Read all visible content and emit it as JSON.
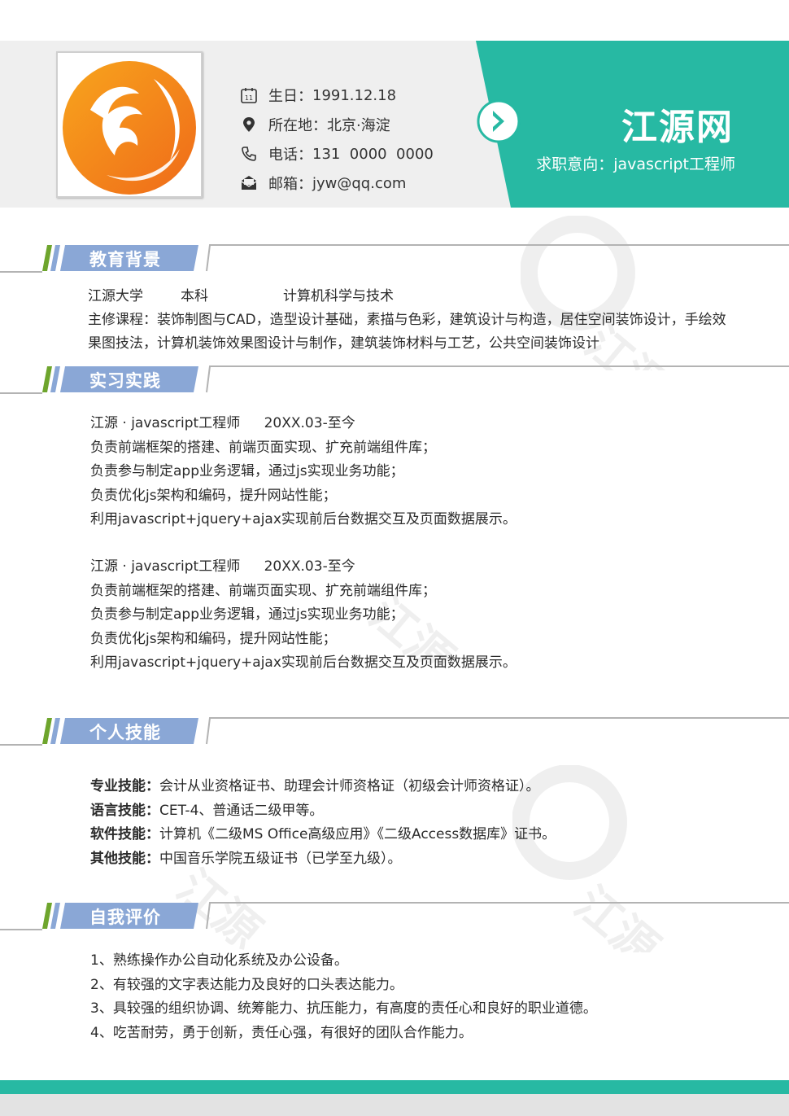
{
  "colors": {
    "teal": "#27b9a3",
    "section_blue": "#8aa7d6",
    "stripe_green": "#6ea52d",
    "header_bg": "#efefef"
  },
  "header": {
    "birthday_label": "生日：",
    "birthday": "1991.12.18",
    "location_label": "所在地：",
    "location": "北京·海淀",
    "phone_label": "电话：",
    "phone": "131  0000  0000",
    "email_label": "邮箱：",
    "email": "jyw@qq.com",
    "calendar_day": "11",
    "name": "江源网",
    "objective": "求职意向：javascript工程师"
  },
  "sections": {
    "education": "教育背景",
    "internship": "实习实践",
    "skills": "个人技能",
    "self_eval": "自我评价"
  },
  "education": {
    "school": "江源大学",
    "degree": "本科",
    "major": "计算机科学与技术",
    "courses_line1": "主修课程：装饰制图与CAD，造型设计基础，素描与色彩，建筑设计与构造，居住空间装饰设计，手绘效",
    "courses_line2": "果图技法，计算机装饰效果图设计与制作，建筑装饰材料与工艺，公共空间装饰设计"
  },
  "experience": [
    {
      "title": "江源 · javascript工程师",
      "period": "20XX.03-至今",
      "lines": [
        "负责前端框架的搭建、前端页面实现、扩充前端组件库；",
        "负责参与制定app业务逻辑，通过js实现业务功能；",
        "负责优化js架构和编码，提升网站性能；",
        "利用javascript+jquery+ajax实现前后台数据交互及页面数据展示。"
      ]
    },
    {
      "title": "江源 · javascript工程师",
      "period": "20XX.03-至今",
      "lines": [
        "负责前端框架的搭建、前端页面实现、扩充前端组件库；",
        "负责参与制定app业务逻辑，通过js实现业务功能；",
        "负责优化js架构和编码，提升网站性能；",
        "利用javascript+jquery+ajax实现前后台数据交互及页面数据展示。"
      ]
    }
  ],
  "skills": [
    {
      "label": "专业技能：",
      "value": "会计从业资格证书、助理会计师资格证（初级会计师资格证）。"
    },
    {
      "label": "语言技能：",
      "value": "CET-4、普通话二级甲等。"
    },
    {
      "label": "软件技能：",
      "value": "计算机《二级MS Office高级应用》《二级Access数据库》证书。"
    },
    {
      "label": "其他技能：",
      "value": "中国音乐学院五级证书（已学至九级）。"
    }
  ],
  "self_eval": [
    "1、熟练操作办公自动化系统及办公设备。",
    "2、有较强的文字表达能力及良好的口头表达能力。",
    "3、具较强的组织协调、统筹能力、抗压能力，有高度的责任心和良好的职业道德。",
    "4、吃苦耐劳，勇于创新，责任心强，有很好的团队合作能力。"
  ],
  "watermark": "江源"
}
